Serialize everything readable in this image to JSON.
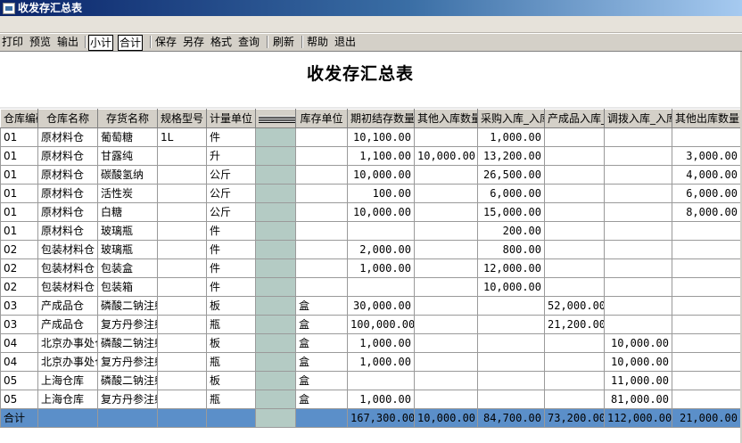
{
  "window": {
    "title": "收发存汇总表"
  },
  "toolbar": {
    "print": "打印",
    "preview": "预览",
    "output": "输出",
    "subtotal": "小计",
    "total": "合计",
    "save": "保存",
    "save_as": "另存",
    "format": "格式",
    "query": "查询",
    "refresh": "刷新",
    "help": "帮助",
    "exit": "退出"
  },
  "report": {
    "title": "收发存汇总表",
    "headers": [
      "仓库编码",
      "仓库名称",
      "存货名称",
      "规格型号",
      "计量单位",
      "",
      "库存单位",
      "期初结存数量",
      "其他入库数量",
      "采购入库_入库数量",
      "产成品入库_入库数量",
      "调拨入库_入库数量",
      "其他出库数量"
    ],
    "rows": [
      [
        "01",
        "原材料仓",
        "葡萄糖",
        "1L",
        "件",
        "",
        "",
        "10,100.00",
        "",
        "1,000.00",
        "",
        "",
        ""
      ],
      [
        "01",
        "原材料仓",
        "甘露纯",
        "",
        "升",
        "",
        "",
        "1,100.00",
        "10,000.00",
        "13,200.00",
        "",
        "",
        "3,000.00"
      ],
      [
        "01",
        "原材料仓",
        "碳酸氢纳",
        "",
        "公斤",
        "",
        "",
        "10,000.00",
        "",
        "26,500.00",
        "",
        "",
        "4,000.00"
      ],
      [
        "01",
        "原材料仓",
        "活性炭",
        "",
        "公斤",
        "",
        "",
        "100.00",
        "",
        "6,000.00",
        "",
        "",
        "6,000.00"
      ],
      [
        "01",
        "原材料仓",
        "白糖",
        "",
        "公斤",
        "",
        "",
        "10,000.00",
        "",
        "15,000.00",
        "",
        "",
        "8,000.00"
      ],
      [
        "01",
        "原材料仓",
        "玻璃瓶",
        "",
        "件",
        "",
        "",
        "",
        "",
        "200.00",
        "",
        "",
        ""
      ],
      [
        "02",
        "包装材料仓",
        "玻璃瓶",
        "",
        "件",
        "",
        "",
        "2,000.00",
        "",
        "800.00",
        "",
        "",
        ""
      ],
      [
        "02",
        "包装材料仓",
        "包装盒",
        "",
        "件",
        "",
        "",
        "1,000.00",
        "",
        "12,000.00",
        "",
        "",
        ""
      ],
      [
        "02",
        "包装材料仓",
        "包装箱",
        "",
        "件",
        "",
        "",
        "",
        "",
        "10,000.00",
        "",
        "",
        ""
      ],
      [
        "03",
        "产成品仓",
        "磷酸二钠注射液",
        "",
        "板",
        "",
        "盒",
        "30,000.00",
        "",
        "",
        "52,000.00",
        "",
        ""
      ],
      [
        "03",
        "产成品仓",
        "复方丹参注射液",
        "",
        "瓶",
        "",
        "盒",
        "100,000.00",
        "",
        "",
        "21,200.00",
        "",
        ""
      ],
      [
        "04",
        "北京办事处仓库",
        "磷酸二钠注射液",
        "",
        "板",
        "",
        "盒",
        "1,000.00",
        "",
        "",
        "",
        "10,000.00",
        ""
      ],
      [
        "04",
        "北京办事处仓库",
        "复方丹参注射液",
        "",
        "瓶",
        "",
        "盒",
        "1,000.00",
        "",
        "",
        "",
        "10,000.00",
        ""
      ],
      [
        "05",
        "上海仓库",
        "磷酸二钠注射液",
        "",
        "板",
        "",
        "盒",
        "",
        "",
        "",
        "",
        "11,000.00",
        ""
      ],
      [
        "05",
        "上海仓库",
        "复方丹参注射液",
        "",
        "瓶",
        "",
        "盒",
        "1,000.00",
        "",
        "",
        "",
        "81,000.00",
        ""
      ]
    ],
    "total_row": [
      "合计",
      "",
      "",
      "",
      "",
      "",
      "",
      "167,300.00",
      "10,000.00",
      "84,700.00",
      "73,200.00",
      "112,000.00",
      "21,000.00"
    ]
  }
}
